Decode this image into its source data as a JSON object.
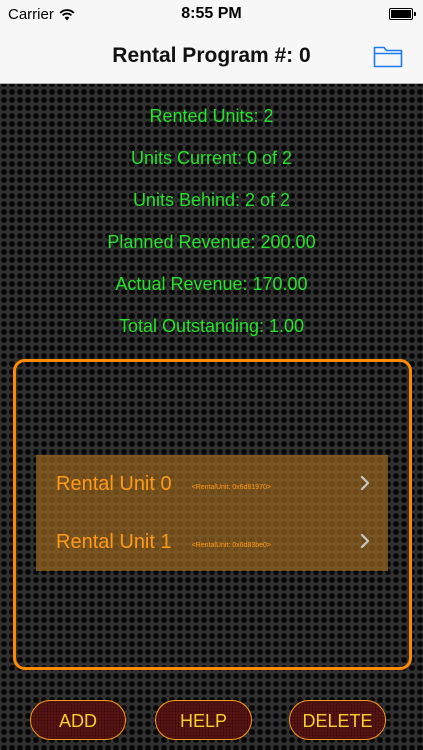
{
  "status_bar": {
    "carrier": "Carrier",
    "time": "8:55 PM",
    "wifi_icon": "wifi-icon",
    "battery_icon": "battery-icon"
  },
  "nav": {
    "title": "Rental Program #: 0",
    "folder_icon": "folder-icon"
  },
  "stats": {
    "rented_units": "Rented Units: 2",
    "units_current": "Units Current: 0 of 2",
    "units_behind": "Units Behind: 2 of 2",
    "planned_revenue": "Planned Revenue: 200.00",
    "actual_revenue": "Actual Revenue: 170.00",
    "total_outstanding": "Total Outstanding: 1.00"
  },
  "units": [
    {
      "title": "Rental Unit 0",
      "subtitle": "<RentalUnit: 0x6d81970>"
    },
    {
      "title": "Rental Unit 1",
      "subtitle": "<RentalUnit: 0x6d83be0>"
    }
  ],
  "buttons": {
    "add": "ADD",
    "help": "HELP",
    "delete": "DELETE"
  },
  "colors": {
    "stat_text": "#23e42a",
    "accent_orange": "#ff8a00",
    "button_text": "#f5cf2a",
    "button_bg": "#5a1414",
    "nav_icon": "#1a7cf5"
  }
}
